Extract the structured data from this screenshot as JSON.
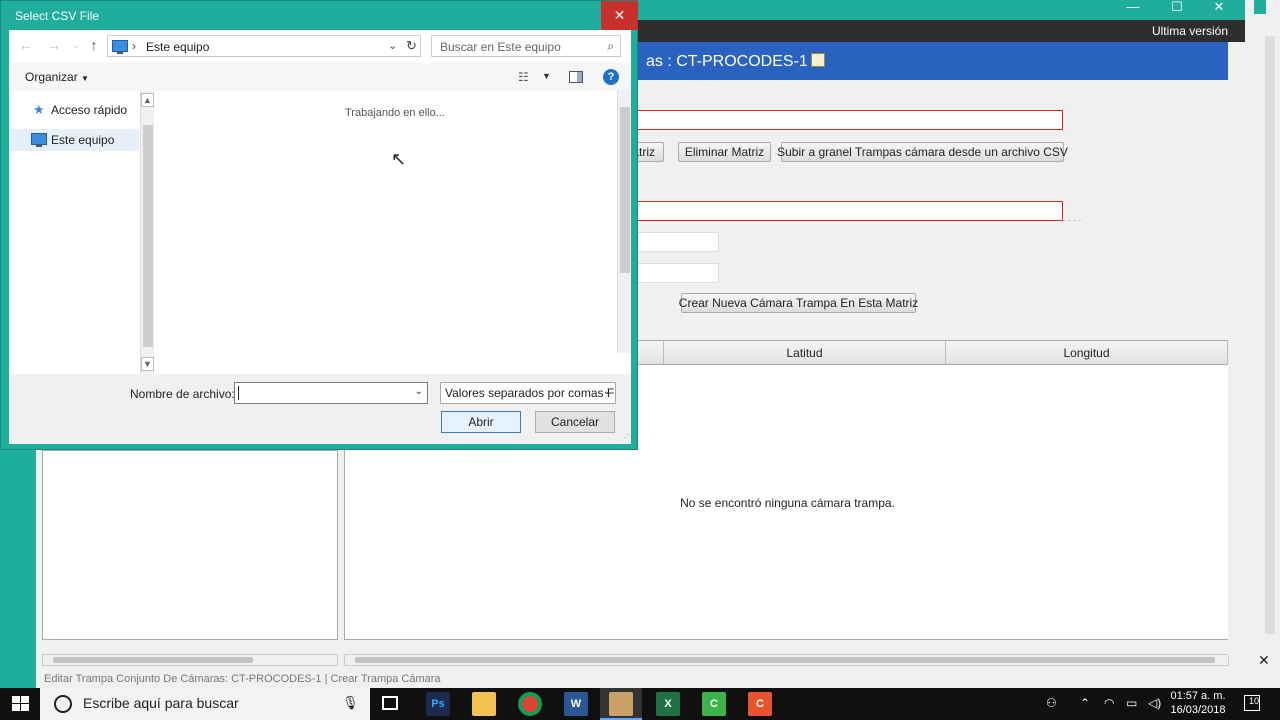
{
  "app": {
    "version_label": "Ultima versión",
    "header_title": "as : CT-PROCODES-1",
    "buttons": {
      "matrix_partial": "atriz",
      "delete_matrix": "Eliminar Matriz",
      "bulk_upload": "Subir a granel Trampas cámara desde un archivo CSV",
      "create_camera": "Crear Nueva Cámara Trampa En Esta Matriz"
    },
    "table": {
      "columns": [
        "Latitud",
        "Longitud"
      ],
      "empty_message": "No se encontró ninguna cámara trampa."
    },
    "statusbar": "Editar Trampa Conjunto De Cámaras: CT-PROCODES-1 | Crear Trampa Cámara"
  },
  "dialog": {
    "title": "Select CSV File",
    "close_glyph": "✕",
    "address": "Este equipo",
    "search_placeholder": "Buscar en Este equipo",
    "organize_label": "Organizar",
    "help_glyph": "?",
    "nav_items": [
      {
        "label": "Acceso rápido",
        "icon": "star-icon"
      },
      {
        "label": "Este equipo",
        "icon": "computer-icon"
      }
    ],
    "working_text": "Trabajando en ello...",
    "filename_label": "Nombre de archivo:",
    "filename_value": "",
    "filetype_value": "Valores separados por comas Fi",
    "open_button": "Abrir",
    "cancel_button": "Cancelar"
  },
  "taskbar": {
    "search_placeholder": "Escribe aquí para buscar",
    "time": "01:57 a. m.",
    "date": "16/03/2018",
    "notifications_count": "10",
    "apps": [
      {
        "name": "photoshop",
        "label": "Ps",
        "color": "#1b2a4e"
      },
      {
        "name": "file-explorer",
        "label": "",
        "color": "#f2c14e"
      },
      {
        "name": "chrome",
        "label": "",
        "color": "#db4437"
      },
      {
        "name": "word",
        "label": "W",
        "color": "#2b5797"
      },
      {
        "name": "active-app",
        "label": "",
        "color": "#c9a26a"
      },
      {
        "name": "excel",
        "label": "X",
        "color": "#1e7145"
      },
      {
        "name": "camtasia-green",
        "label": "C",
        "color": "#3bb54a"
      },
      {
        "name": "camtasia-orange",
        "label": "C",
        "color": "#e8532f"
      }
    ]
  }
}
